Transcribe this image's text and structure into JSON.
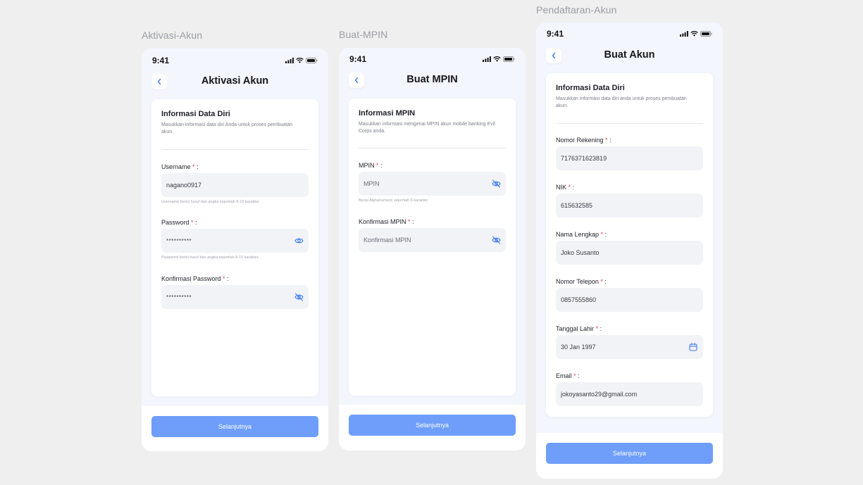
{
  "frames": {
    "aktivasi": {
      "frame_label": "Aktivasi-Akun",
      "status_time": "9:41",
      "title": "Aktivasi Akun",
      "card_title": "Informasi Data Diri",
      "card_desc": "Masukkan informasi data diri Anda untuk proses pembuatan akun.",
      "fields": [
        {
          "label": "Username",
          "value": "nagano0917",
          "hint": "Username berisi huruf dan angka sejumlah 8-10 karakter."
        },
        {
          "label": "Password",
          "value": "**********",
          "hint": "Password berisi huruf dan angka sejumlah 8-10 karakter.",
          "icon": "eye-icon"
        },
        {
          "label": "Konfirmasi Password",
          "value": "**********",
          "icon": "eye-off-icon"
        }
      ],
      "button": "Selanjutnya"
    },
    "mpin": {
      "frame_label": "Buat-MPIN",
      "status_time": "9:41",
      "title": "Buat MPIN",
      "card_title": "Informasi MPIN",
      "card_desc": "Masukkan informasi mengenai MPIN akun mobile banking Evil Corps anda.",
      "fields": [
        {
          "label": "MPIN",
          "placeholder": "MPIN",
          "hint": "Berisi Alphanumeric sejumlah 6 karakter.",
          "icon": "eye-off-icon"
        },
        {
          "label": "Konfirmasi MPIN",
          "placeholder": "Konfirmasi MPIN",
          "icon": "eye-off-icon"
        }
      ],
      "button": "Selanjutnya"
    },
    "pendaftaran": {
      "frame_label": "Pendaftaran-Akun",
      "status_time": "9:41",
      "title": "Buat Akun",
      "card_title": "Informasi Data Diri",
      "card_desc": "Masukkan informasi data diri anda untuk proses pembuatan akun.",
      "fields": [
        {
          "label": "Nomor Rekening",
          "value": "7176371623819"
        },
        {
          "label": "NIK",
          "value": "615632585"
        },
        {
          "label": "Nama Lengkap",
          "value": "Joko Susanto"
        },
        {
          "label": "Nomor Telepon",
          "value": "0857555860"
        },
        {
          "label": "Tanggal Lahir",
          "value": "30 Jan 1997",
          "icon": "calendar-icon"
        },
        {
          "label": "Email",
          "value": "jokoyasanto29@gmail.com"
        }
      ],
      "button": "Selanjutnya"
    }
  },
  "required_marker": "*",
  "label_suffix": ":",
  "colors": {
    "background": "#efefef",
    "phone_top": "#f3f6fd",
    "primary_button": "#6e9ef9",
    "required": "#e6424a",
    "input_bg": "#f2f3f7",
    "icon_blue": "#3f7bea"
  }
}
